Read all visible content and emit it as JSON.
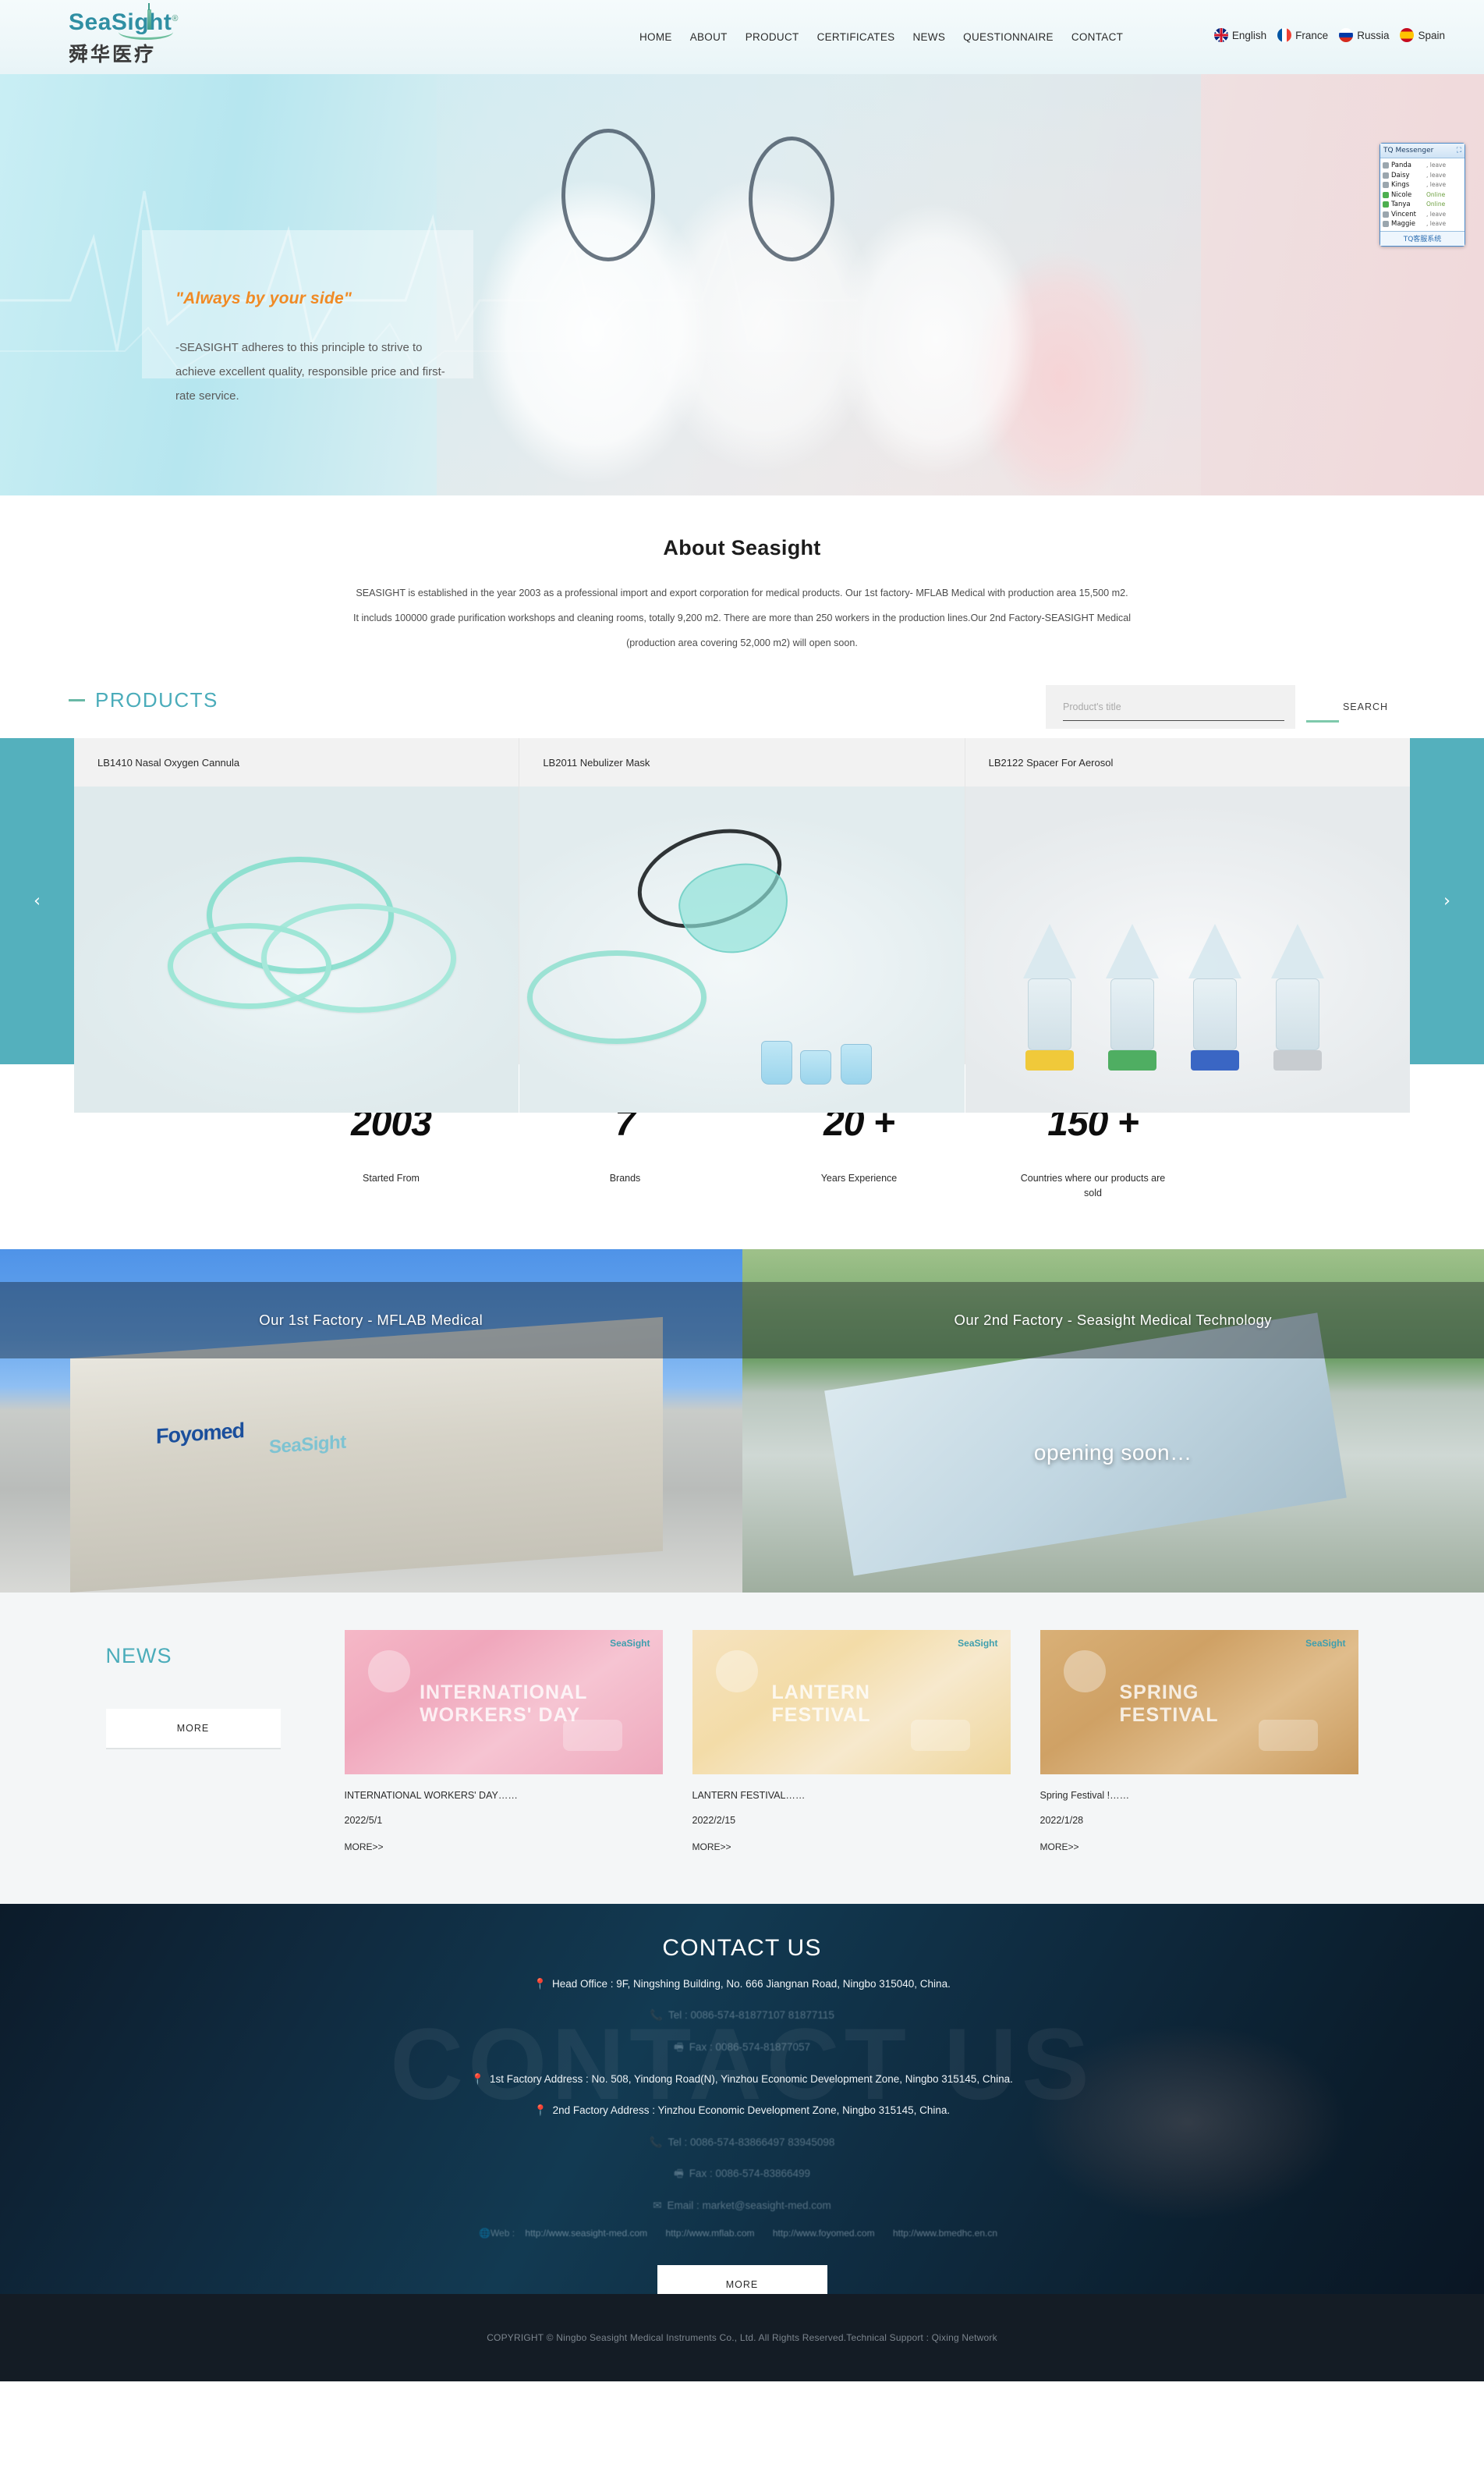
{
  "header": {
    "logo_main": "SeaSight",
    "logo_reg": "®",
    "logo_cn": "舜华医疗",
    "nav": [
      {
        "label": "HOME"
      },
      {
        "label": "ABOUT"
      },
      {
        "label": "PRODUCT"
      },
      {
        "label": "CERTIFICATES"
      },
      {
        "label": "NEWS"
      },
      {
        "label": "QUESTIONNAIRE"
      },
      {
        "label": "CONTACT"
      }
    ],
    "languages": [
      {
        "label": "English",
        "flag": "uk-flag-icon"
      },
      {
        "label": "France",
        "flag": "france-flag-icon"
      },
      {
        "label": "Russia",
        "flag": "russia-flag-icon"
      },
      {
        "label": "Spain",
        "flag": "spain-flag-icon"
      }
    ]
  },
  "hero": {
    "quote": "\"Always by your side\"",
    "subtext": "-SEASIGHT adheres to this principle to strive to achieve excellent quality, responsible price and first-rate service."
  },
  "messenger": {
    "title": "TQ Messenger",
    "minimize_icon": "minimize-icon",
    "contacts": [
      {
        "name": "Panda",
        "status": ", leave"
      },
      {
        "name": "Daisy",
        "status": ", leave"
      },
      {
        "name": "Kings",
        "status": ", leave"
      },
      {
        "name": "Nicole",
        "status": "Online"
      },
      {
        "name": "Tanya",
        "status": "Online"
      },
      {
        "name": "Vincent",
        "status": ", leave"
      },
      {
        "name": "Maggie",
        "status": ", leave"
      }
    ],
    "footer": "TQ客服系统"
  },
  "about": {
    "title": "About Seasight",
    "body": "SEASIGHT is established in the year 2003 as a professional import and export corporation for medical products. Our 1st  factory- MFLAB Medical with production area 15,500 m2. It includs 100000 grade purification workshops and cleaning rooms, totally 9,200 m2. There are more than 250 workers in the production lines.Our 2nd Factory-SEASIGHT Medical (production area covering 52,000 m2) will open soon."
  },
  "products": {
    "section_title": "PRODUCTS",
    "search_placeholder": "Product's title",
    "search_value": "",
    "search_button": "SEARCH",
    "prev_arrow": "‹",
    "next_arrow": "›",
    "items": [
      {
        "title": "LB1410 Nasal Oxygen Cannula"
      },
      {
        "title": "LB2011 Nebulizer Mask"
      },
      {
        "title": "LB2122 Spacer For Aerosol"
      }
    ]
  },
  "stats": [
    {
      "number": "2003",
      "label": "Started From"
    },
    {
      "number": "7",
      "label": "Brands"
    },
    {
      "number": "20 +",
      "label": "Years Experience"
    },
    {
      "number": "150 +",
      "label": "Countries where our products are sold"
    }
  ],
  "factories": [
    {
      "caption": "Our 1st  Factory - MFLAB Medical",
      "overlay": "",
      "brand1": "Foyomed",
      "brand2": "SeaSight"
    },
    {
      "caption": "Our 2nd Factory - Seasight Medical Technology",
      "overlay": "opening soon…"
    }
  ],
  "news": {
    "title": "NEWS",
    "more_label": "MORE",
    "items": [
      {
        "title": "INTERNATIONAL WORKERS' DAY……",
        "date": "2022/5/1",
        "more": "MORE>>",
        "thumb_text": "INTERNATIONAL WORKERS' DAY",
        "brand": "SeaSight"
      },
      {
        "title": "LANTERN FESTIVAL……",
        "date": "2022/2/15",
        "more": "MORE>>",
        "thumb_text": "LANTERN FESTIVAL",
        "brand": "SeaSight"
      },
      {
        "title": "Spring Festival !……",
        "date": "2022/1/28",
        "more": "MORE>>",
        "thumb_text": "SPRING FESTIVAL",
        "brand": "SeaSight"
      }
    ]
  },
  "contact": {
    "title": "CONTACT US",
    "ghost_text": "CONTACT US",
    "head_office": "Head Office : 9F, Ningshing Building, No. 666 Jiangnan Road, Ningbo 315040, China.",
    "tel": "Tel : 0086-574-81877107  81877115",
    "fax_top": "Fax : 0086-574-81877057",
    "factory1": "1st Factory Address : No. 508, Yindong Road(N), Yinzhou Economic Development Zone, Ningbo 315145, China.",
    "factory2": "2nd Factory Address : Yinzhou Economic Development Zone, Ningbo 315145, China.",
    "tel2": "Tel : 0086-574-83866497  83945098",
    "fax2": "Fax : 0086-574-83866499",
    "email": "Email : market@seasight-med.com",
    "web_label": "Web :",
    "web_links": [
      "http://www.seasight-med.com",
      "http://www.mflab.com",
      "http://www.foyomed.com",
      "http://www.bmedhc.en.cn"
    ],
    "more_label": "MORE",
    "icons": {
      "location": "location-pin-icon",
      "phone": "phone-icon",
      "fax": "fax-icon",
      "email": "email-icon",
      "web": "globe-icon"
    }
  },
  "footer": {
    "copyright": "COPYRIGHT © Ningbo Seasight Medical Instruments Co., Ltd. All Rights Reserved.Technical Support : Qixing Network"
  },
  "colors": {
    "teal": "#4aacba",
    "teal_edge": "#54b0bd",
    "orange": "#f08a24",
    "green": "#69b8a6",
    "dark": "#141c25"
  }
}
